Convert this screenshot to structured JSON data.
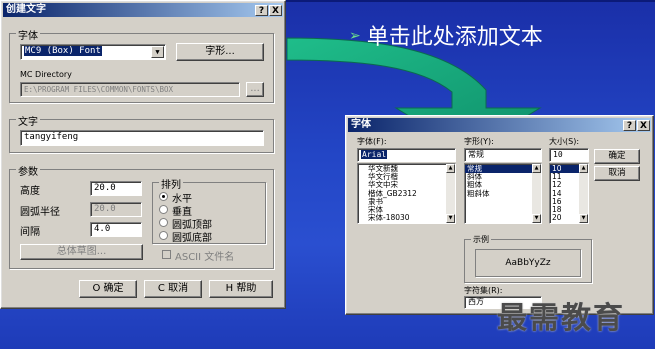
{
  "slide": {
    "bullet_text": "单击此处添加文本",
    "bullet_marker": "➢",
    "watermark": "最需教育"
  },
  "dialog1": {
    "title": "创建文字",
    "help_btn": "?",
    "close_btn": "X",
    "font_group": "字体",
    "font_value": "MC9 (Box) Font",
    "font_style_btn": "字形...",
    "mc_directory_label": "MC Directory",
    "mc_directory_value": "E:\\PROGRAM FILES\\COMMON\\FONTS\\BOX",
    "browse_btn": "...",
    "text_group": "文字",
    "text_value": "tangyifeng",
    "params_group": "参数",
    "height_label": "高度",
    "height_value": "20.0",
    "arc_radius_label": "圆弧半径",
    "arc_radius_value": "20.0",
    "spacing_label": "间隔",
    "spacing_value": "4.0",
    "overview_btn": "总体草图...",
    "align_group": "排列",
    "align_options": [
      "水平",
      "垂直",
      "圆弧顶部",
      "圆弧底部"
    ],
    "align_selected": "水平",
    "ascii_label": "ASCII 文件名",
    "ok_btn": "O 确定",
    "cancel_btn": "C 取消",
    "help_btn_bottom": "H 帮助"
  },
  "dialog2": {
    "title": "字体",
    "help_btn": "?",
    "close_btn": "X",
    "font_label": "字体(F):",
    "font_value": "Arial",
    "font_list": [
      "华文新魏",
      "华文行楷",
      "华文中宋",
      "楷体_GB2312",
      "隶书",
      "宋体",
      "宋体-18030"
    ],
    "style_label": "字形(Y):",
    "style_value": "常规",
    "style_list": [
      "常规",
      "斜体",
      "粗体",
      "粗斜体"
    ],
    "size_label": "大小(S):",
    "size_value": "10",
    "size_list": [
      "10",
      "11",
      "12",
      "14",
      "16",
      "18",
      "20"
    ],
    "ok_btn": "确定",
    "cancel_btn": "取消",
    "sample_group": "示例",
    "sample_text": "AaBbYyZz",
    "charset_label": "字符集(R):",
    "charset_value": "西方"
  },
  "colors": {
    "background": "#2346c6",
    "arrow": "#14a87a",
    "titlebar": "#0a246a",
    "dialog_face": "#d4d0c8"
  }
}
